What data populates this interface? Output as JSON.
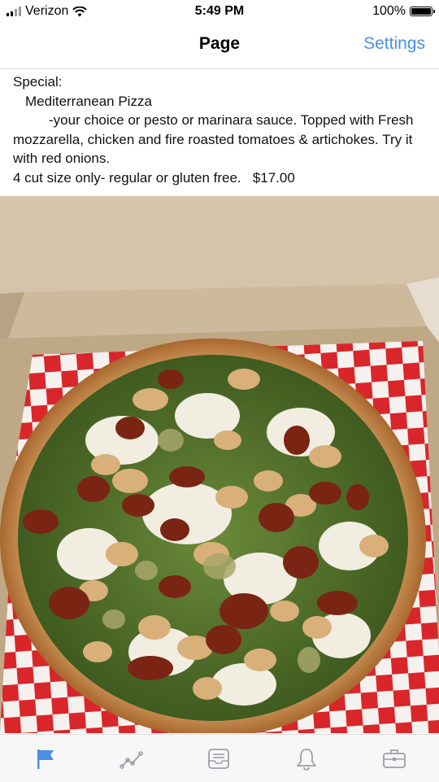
{
  "status_bar": {
    "carrier": "Verizon",
    "time": "5:49 PM",
    "battery": "100%"
  },
  "navbar": {
    "title": "Page",
    "settings_label": "Settings"
  },
  "post": {
    "line1": "Special:",
    "line2": "Mediterranean Pizza",
    "line3": "-your choice or pesto or marinara sauce. Topped with Fresh mozzarella, chicken and fire roasted tomatoes & artichokes. Try it with red onions.",
    "line4": "4 cut size only- regular or gluten free.   $17.00"
  },
  "tabbar": {
    "tabs": [
      {
        "icon": "flag-icon",
        "active": true
      },
      {
        "icon": "activity-icon",
        "active": false
      },
      {
        "icon": "inbox-icon",
        "active": false
      },
      {
        "icon": "bell-icon",
        "active": false
      },
      {
        "icon": "briefcase-icon",
        "active": false
      }
    ],
    "active_color": "#4a8fe7",
    "inactive_color": "#9aa0a8"
  }
}
